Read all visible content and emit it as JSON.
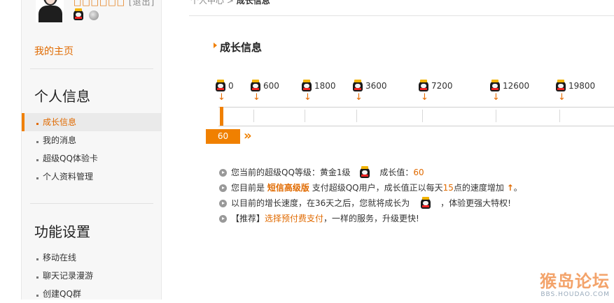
{
  "sidebar": {
    "nickname": "□□□□□□",
    "logout": "[退出]",
    "home_link": "我的主页",
    "personal_title": "个人信息",
    "personal_items": [
      {
        "label": "成长信息"
      },
      {
        "label": "我的消息"
      },
      {
        "label": "超级QQ体验卡"
      },
      {
        "label": "个人资料管理"
      }
    ],
    "settings_title": "功能设置",
    "settings_items": [
      {
        "label": "移动在线"
      },
      {
        "label": "聊天记录漫游"
      },
      {
        "label": "创建QQ群"
      }
    ]
  },
  "header": {
    "breadcrumb_home": "个人中心 >",
    "breadcrumb_current": "成长信息"
  },
  "main": {
    "title": "成长信息",
    "milestones": [
      "0",
      "600",
      "1800",
      "3600",
      "7200",
      "12600",
      "19800"
    ],
    "progress": {
      "current_value": "60",
      "next_milestone": 600,
      "fraction_to_next": 0.1
    },
    "info": {
      "line1_prefix": "您当前的超级QQ等级：黄金1级",
      "line1_growth_label": "成长值：",
      "line1_growth_value": "60",
      "line2_prefix": "您目前是",
      "line2_highlight": "短信高级版",
      "line2_mid": "支付超级QQ用户，成长值正以每天",
      "line2_rate": "15",
      "line2_suffix": "点的速度增加",
      "line3_prefix": "以目前的增长速度，在36天之后，您就将成长为",
      "line3_suffix": "，体验更强大特权!",
      "line4_prefix": "【推荐】",
      "line4_link": "选择预付费支付",
      "line4_suffix": "，一样的服务，升级更快!"
    }
  },
  "watermark": {
    "text": "猴岛论坛",
    "sub": "BBS.HOUDAO.COM"
  },
  "colors": {
    "accent": "#f08000",
    "link": "#e06a00"
  }
}
